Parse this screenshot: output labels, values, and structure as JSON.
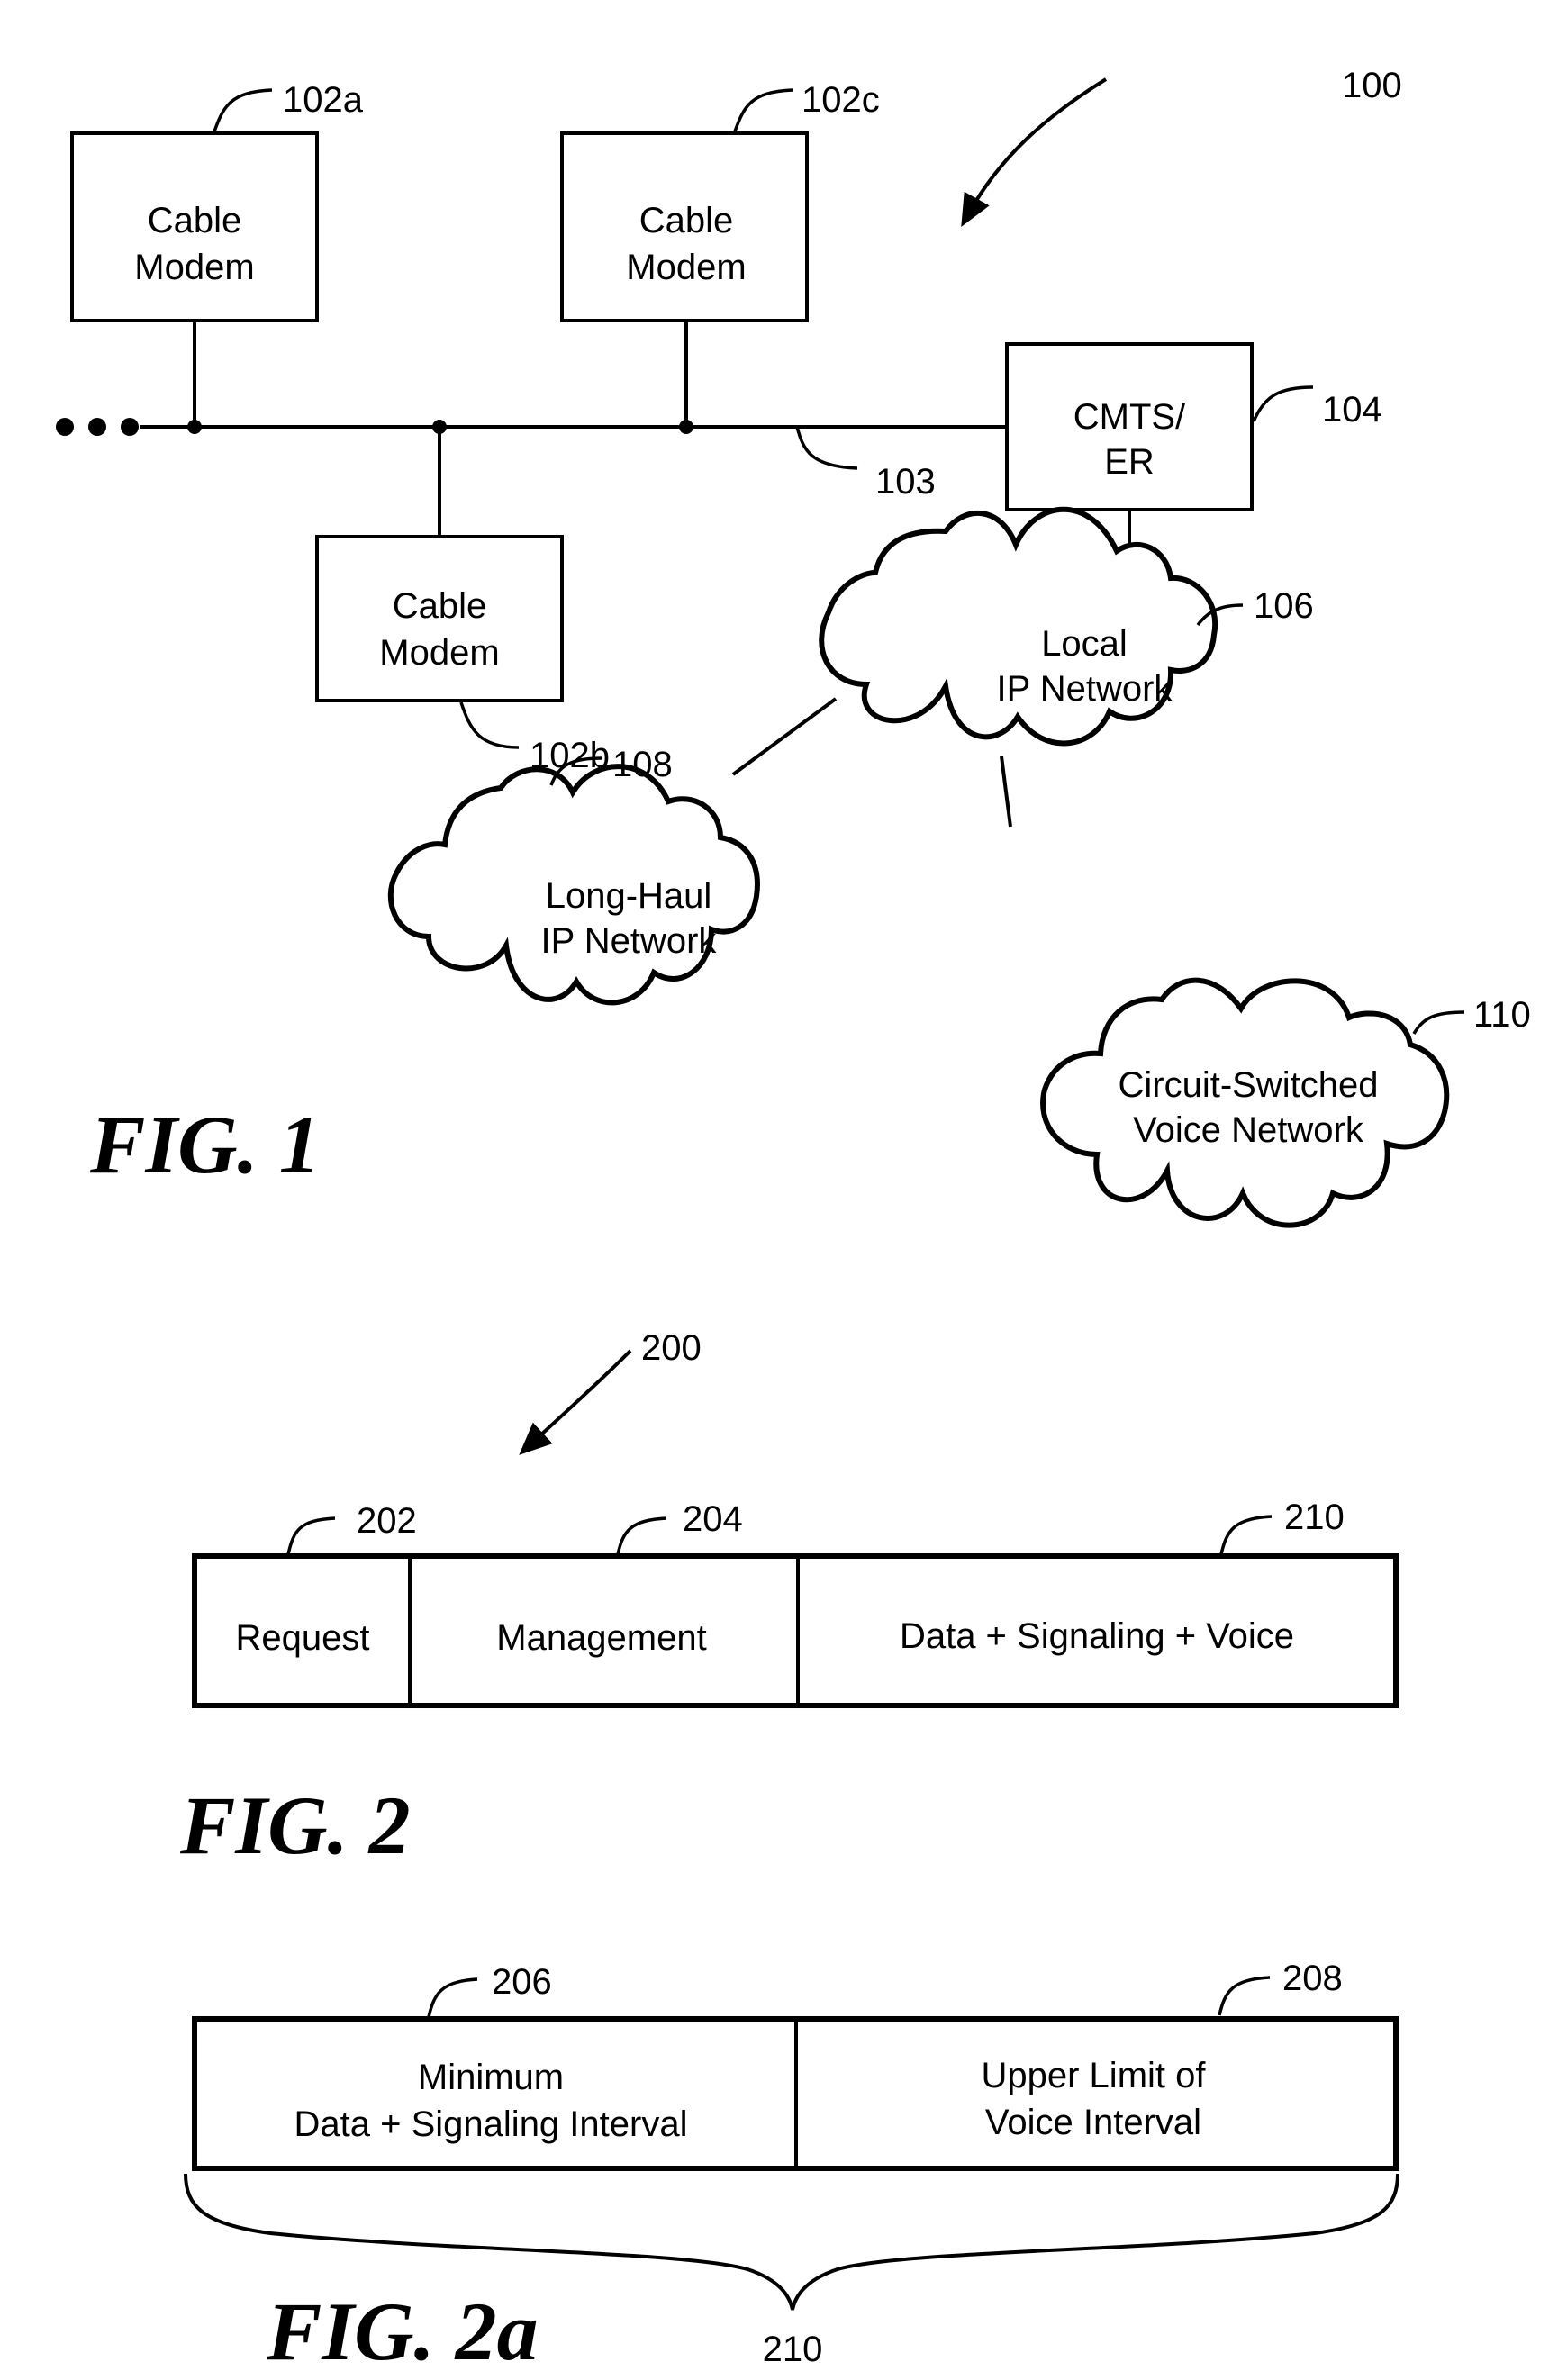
{
  "fig1": {
    "caption": "FIG. 1",
    "system_ref": "100",
    "bus_ref": "103",
    "continuation": "•••",
    "cable_modem_a": {
      "line1": "Cable",
      "line2": "Modem",
      "ref": "102a"
    },
    "cable_modem_b": {
      "line1": "Cable",
      "line2": "Modem",
      "ref": "102b"
    },
    "cable_modem_c": {
      "line1": "Cable",
      "line2": "Modem",
      "ref": "102c"
    },
    "cmts": {
      "line1": "CMTS/",
      "line2": "ER",
      "ref": "104"
    },
    "local_ip": {
      "line1": "Local",
      "line2": "IP Network",
      "ref": "106"
    },
    "long_haul": {
      "line1": "Long-Haul",
      "line2": "IP Network",
      "ref": "108"
    },
    "circuit_switched": {
      "line1": "Circuit-Switched",
      "line2": "Voice Network",
      "ref": "110"
    }
  },
  "fig2": {
    "caption": "FIG. 2",
    "frame_ref": "200",
    "segments": [
      {
        "label": "Request",
        "ref": "202"
      },
      {
        "label": "Management",
        "ref": "204"
      },
      {
        "label": "Data + Signaling + Voice",
        "ref": "210"
      }
    ]
  },
  "fig2a": {
    "caption": "FIG. 2a",
    "brace_ref": "210",
    "segments": [
      {
        "line1": "Minimum",
        "line2": "Data + Signaling Interval",
        "ref": "206"
      },
      {
        "line1": "Upper Limit of",
        "line2": "Voice Interval",
        "ref": "208"
      }
    ]
  }
}
